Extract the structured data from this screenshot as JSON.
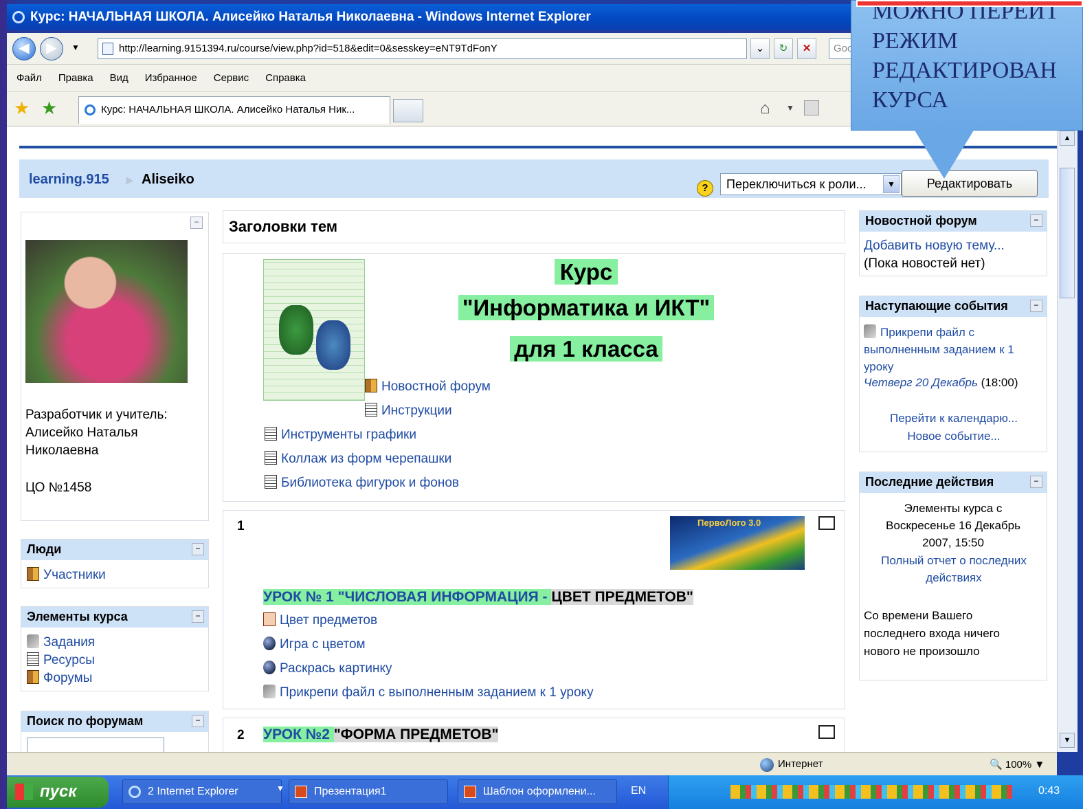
{
  "window": {
    "title": "Курс: НАЧАЛЬНАЯ ШКОЛА. Алисейко Наталья Николаевна - Windows Internet Explorer"
  },
  "address": {
    "url": "http://learning.9151394.ru/course/view.php?id=518&edit=0&sesskey=eNT9TdFonY",
    "search_stub": "Goo"
  },
  "menu": [
    "Файл",
    "Правка",
    "Вид",
    "Избранное",
    "Сервис",
    "Справка"
  ],
  "tab": {
    "label": "Курс: НАЧАЛЬНАЯ ШКОЛА. Алисейко Наталья Ник..."
  },
  "callout": {
    "lines": [
      "МОЖНО ПЕРЕЙТ",
      "РЕЖИМ",
      "РЕДАКТИРОВАН",
      "КУРСА"
    ]
  },
  "navbar": {
    "home": "learning.915",
    "sep": "►",
    "current": "Aliseiko",
    "role_select": "Переключиться к роли...",
    "edit_button": "Редактировать",
    "help": "?"
  },
  "left": {
    "profile": {
      "caption1": "Разработчик и учитель:",
      "caption2": "Алисейко Наталья",
      "caption3": "Николаевна",
      "caption4": "ЦО №1458"
    },
    "people": {
      "title": "Люди",
      "items": [
        "Участники"
      ]
    },
    "activities": {
      "title": "Элементы курса",
      "items": [
        "Задания",
        "Ресурсы",
        "Форумы"
      ]
    },
    "search": {
      "title": "Поиск по форумам"
    }
  },
  "main": {
    "header": "Заголовки тем",
    "course_title1": "Курс",
    "course_title2": "\"Информатика и ИКТ\"",
    "course_title3": "для 1 класса",
    "section0_links": [
      "Новостной форум",
      "Инструкции",
      "Инструменты графики",
      "Коллаж из форм черепашки",
      "Библиотека фигурок и фонов"
    ],
    "section1": {
      "num": "1",
      "logo_text": "ПервоЛого 3.0",
      "title_a": "УРОК № 1   \"ЧИСЛОВАЯ ИНФОРМАЦИЯ - ",
      "title_b": "ЦВЕТ ПРЕДМЕТОВ\"",
      "links": [
        "Цвет предметов",
        "Игра с цветом",
        "Раскрась картинку",
        "Прикрепи файл с выполненным заданием к 1 уроку"
      ]
    },
    "section2": {
      "num": "2",
      "title_a": "УРОК №2    ",
      "title_b": "\"ФОРМА ПРЕДМЕТОВ\""
    }
  },
  "right": {
    "news": {
      "title": "Новостной форум",
      "link": "Добавить новую тему...",
      "empty": "(Пока новостей нет)"
    },
    "events": {
      "title": "Наступающие события",
      "event": "Прикрепи файл с выполненным заданием к 1 уроку",
      "date": "Четверг 20 Декабрь",
      "time": "(18:00)",
      "calendar": "Перейти к календарю...",
      "new_event": "Новое событие..."
    },
    "recent": {
      "title": "Последние действия",
      "since": "Элементы курса с Воскресенье 16 Декабрь 2007, 15:50",
      "full_report": "Полный отчет о последних действиях",
      "none": "Со времени Вашего последнего входа ничего нового не произошло"
    }
  },
  "status": {
    "zone": "Интернет",
    "zoom": "100%"
  },
  "taskbar": {
    "start": "пуск",
    "items": [
      "2 Internet Explorer",
      "Презентация1",
      "Шаблон оформлени..."
    ],
    "lang": "EN",
    "clock": "0:43"
  }
}
